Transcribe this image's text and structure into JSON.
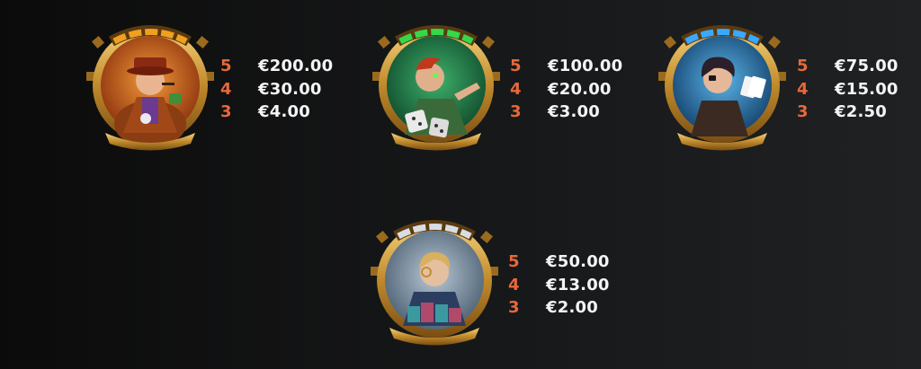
{
  "currency": "€",
  "symbols": [
    {
      "character": "gentleman-tycoon",
      "light_color": "#f0a020",
      "bg_color": "#d4661f",
      "payouts": [
        {
          "count": "5",
          "amount": "€200.00"
        },
        {
          "count": "4",
          "amount": "€30.00"
        },
        {
          "count": "3",
          "amount": "€4.00"
        }
      ]
    },
    {
      "character": "dice-gambler",
      "light_color": "#35d84a",
      "bg_color": "#1f8a50",
      "payouts": [
        {
          "count": "5",
          "amount": "€100.00"
        },
        {
          "count": "4",
          "amount": "€20.00"
        },
        {
          "count": "3",
          "amount": "€3.00"
        }
      ]
    },
    {
      "character": "card-player",
      "light_color": "#3aa8ff",
      "bg_color": "#2a7fc0",
      "payouts": [
        {
          "count": "5",
          "amount": "€75.00"
        },
        {
          "count": "4",
          "amount": "€15.00"
        },
        {
          "count": "3",
          "amount": "€2.50"
        }
      ]
    },
    {
      "character": "chip-dealer",
      "light_color": "#d8dde4",
      "bg_color": "#8fa3b3",
      "payouts": [
        {
          "count": "5",
          "amount": "€50.00"
        },
        {
          "count": "4",
          "amount": "€13.00"
        },
        {
          "count": "3",
          "amount": "€2.00"
        }
      ]
    }
  ]
}
